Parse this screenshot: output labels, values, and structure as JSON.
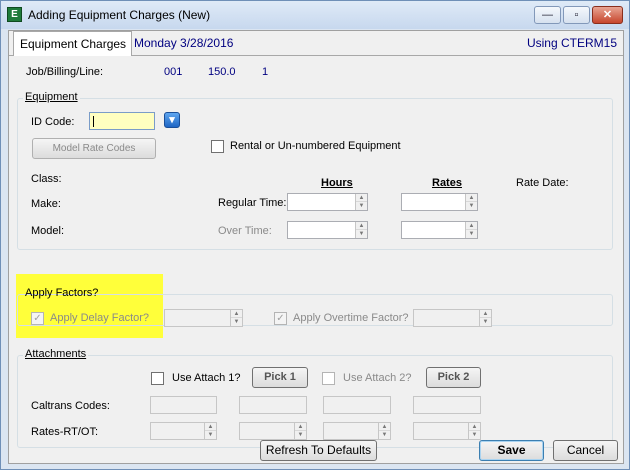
{
  "window": {
    "title": "Adding Equipment Charges  (New)",
    "app_icon_letter": "E",
    "minimize": "—",
    "maximize": "▫",
    "close": "✕"
  },
  "header": {
    "tab_label": "Equipment Charges",
    "date": "Monday  3/28/2016",
    "term": "Using CTERM15"
  },
  "job": {
    "label": "Job/Billing/Line:",
    "job": "001",
    "billing": "150.0",
    "line": "1"
  },
  "equipment": {
    "group_label": "Equipment",
    "id_code_label": "ID Code:",
    "id_code_value": "",
    "model_rate_codes_button": "Model Rate Codes",
    "rental_checkbox_label": "Rental or Un-numbered Equipment",
    "class_label": "Class:",
    "make_label": "Make:",
    "model_label": "Model:",
    "hours_header": "Hours",
    "rates_header": "Rates",
    "rate_date_label": "Rate Date:",
    "regular_time_label": "Regular Time:",
    "over_time_label": "Over Time:"
  },
  "factors": {
    "group_label": "Apply Factors?",
    "delay_label": "Apply Delay Factor?",
    "delay_checked": true,
    "overtime_label": "Apply Overtime Factor?",
    "overtime_checked": true
  },
  "attachments": {
    "group_label": "Attachments",
    "use_attach1_label": "Use Attach 1?",
    "pick1_button": "Pick 1",
    "use_attach2_label": "Use Attach 2?",
    "pick2_button": "Pick 2",
    "caltrans_label": "Caltrans Codes:",
    "rates_label": "Rates-RT/OT:"
  },
  "footer": {
    "refresh_button": "Refresh To Defaults",
    "save_button": "Save",
    "cancel_button": "Cancel"
  },
  "colors": {
    "highlight": "#ffff3a",
    "header_text": "#000080"
  }
}
